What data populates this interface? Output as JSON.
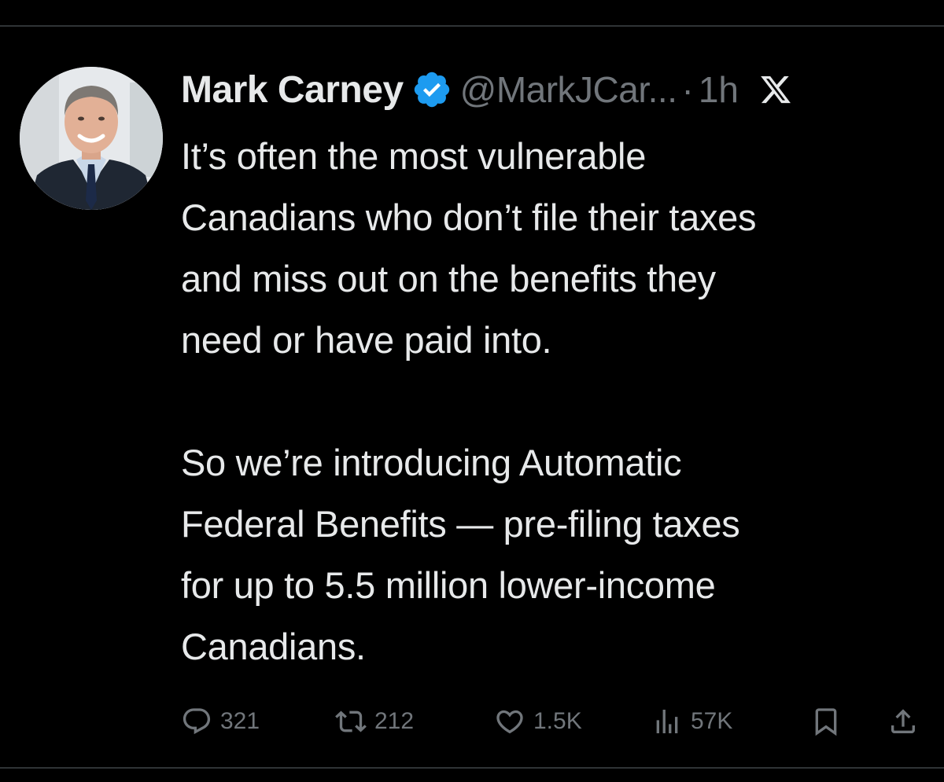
{
  "tweet": {
    "author": {
      "display_name": "Mark Carney",
      "handle": "@MarkJCar...",
      "verified": true
    },
    "separator": "·",
    "time": "1h",
    "paragraphs": [
      "It’s often the most vulnerable\nCanadians who don’t file their taxes\nand miss out on the benefits they\nneed or have paid into.",
      "So we’re introducing Automatic\nFederal Benefits — pre-filing taxes\nfor up to 5.5 million lower-income\nCanadians."
    ]
  },
  "actions": {
    "replies": "321",
    "reposts": "212",
    "likes": "1.5K",
    "views": "57K"
  },
  "icons": {
    "verified": "verified-badge-icon",
    "platform": "x-logo-icon",
    "reply": "reply-icon",
    "repost": "repost-icon",
    "like": "heart-icon",
    "views": "views-icon",
    "bookmark": "bookmark-icon",
    "share": "share-icon"
  },
  "colors": {
    "background": "#000000",
    "text": "#e7e9ea",
    "muted": "#71767b",
    "verified_blue": "#1d9bf0",
    "divider": "#2f3336"
  }
}
